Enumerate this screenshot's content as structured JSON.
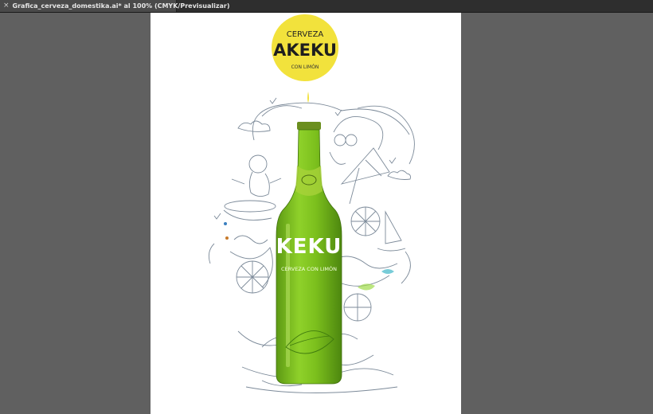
{
  "document_tab": {
    "close_glyph": "×",
    "title": "Grafica_cerveza_domestika.ai* al 100% (CMYK/Previsualizar)"
  },
  "artwork": {
    "logo": {
      "line1": "CERVEZA",
      "line2": "AKEKU",
      "line3": "CON LIMÓN",
      "color": "#f2e23c"
    },
    "bottle": {
      "brand": "KEKU",
      "tagline": "CERVEZA CON LIMÓN",
      "glass_color": "#7fbf1e",
      "cap_color": "#6b8f1e"
    }
  }
}
